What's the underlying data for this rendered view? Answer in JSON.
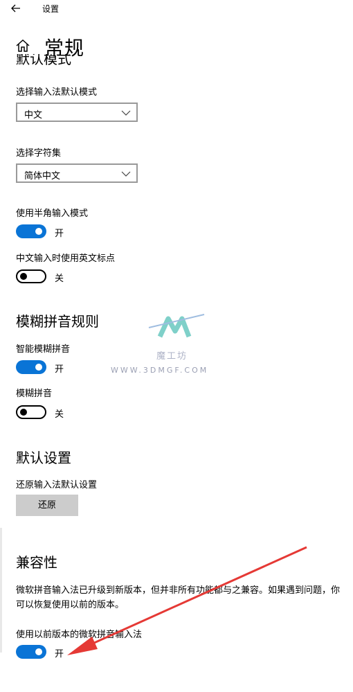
{
  "window": {
    "title": "设置"
  },
  "page": {
    "title": "常规",
    "partial_heading": "默认模式"
  },
  "input_default_mode": {
    "label": "选择输入法默认模式",
    "value": "中文"
  },
  "charset": {
    "label": "选择字符集",
    "value": "简体中文"
  },
  "half_width": {
    "label": "使用半角输入模式",
    "state": "开"
  },
  "english_punct": {
    "label": "中文输入时使用英文标点",
    "state": "关"
  },
  "fuzzy": {
    "heading": "模糊拼音规则",
    "smart": {
      "label": "智能模糊拼音",
      "state": "开"
    },
    "fuzzy_pinyin": {
      "label": "模糊拼音",
      "state": "关"
    }
  },
  "defaults": {
    "heading": "默认设置",
    "label": "还原输入法默认设置",
    "button": "还原"
  },
  "compat": {
    "heading": "兼容性",
    "description": "微软拼音输入法已升级到新版本，但并非所有功能都与之兼容。如果遇到问题，你可以恢复使用以前的版本。",
    "toggle_label": "使用以前版本的微软拼音输入法",
    "state": "开"
  },
  "watermark": {
    "cn": "魔工坊",
    "url": "WWW.3DMGF.COM"
  },
  "colors": {
    "accent": "#0a74d6",
    "arrow": "#e53935",
    "button_bg": "#cccccc"
  }
}
